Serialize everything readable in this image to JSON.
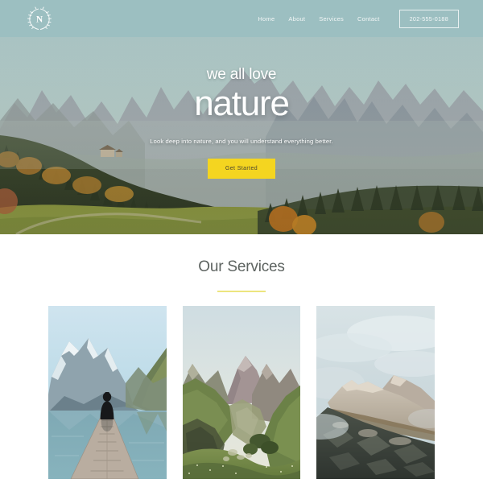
{
  "header": {
    "logo_alt": "laurel-wreath-monogram",
    "logo_letter": "N",
    "nav_items": [
      {
        "label": "Home"
      },
      {
        "label": "About"
      },
      {
        "label": "Services"
      },
      {
        "label": "Contact"
      }
    ],
    "phone_label": "202-555-0188",
    "bg_color": "#9cbfc1"
  },
  "hero": {
    "kicker": "we all love",
    "title": "nature",
    "subtitle": "Look deep into nature, and you will understand everything better.",
    "cta_label": "Get Started",
    "cta_color": "#f4d520",
    "scene": "autumn alpine valley with dolomite peaks, conifer forest and green meadow"
  },
  "services": {
    "title": "Our Services",
    "rule_color": "#ece57e",
    "cards": [
      {
        "alt": "person sitting on wooden dock at a mountain lake"
      },
      {
        "alt": "green alpine valley with distant mountain peaks"
      },
      {
        "alt": "rocky mountain ridge rising through mist"
      }
    ]
  }
}
